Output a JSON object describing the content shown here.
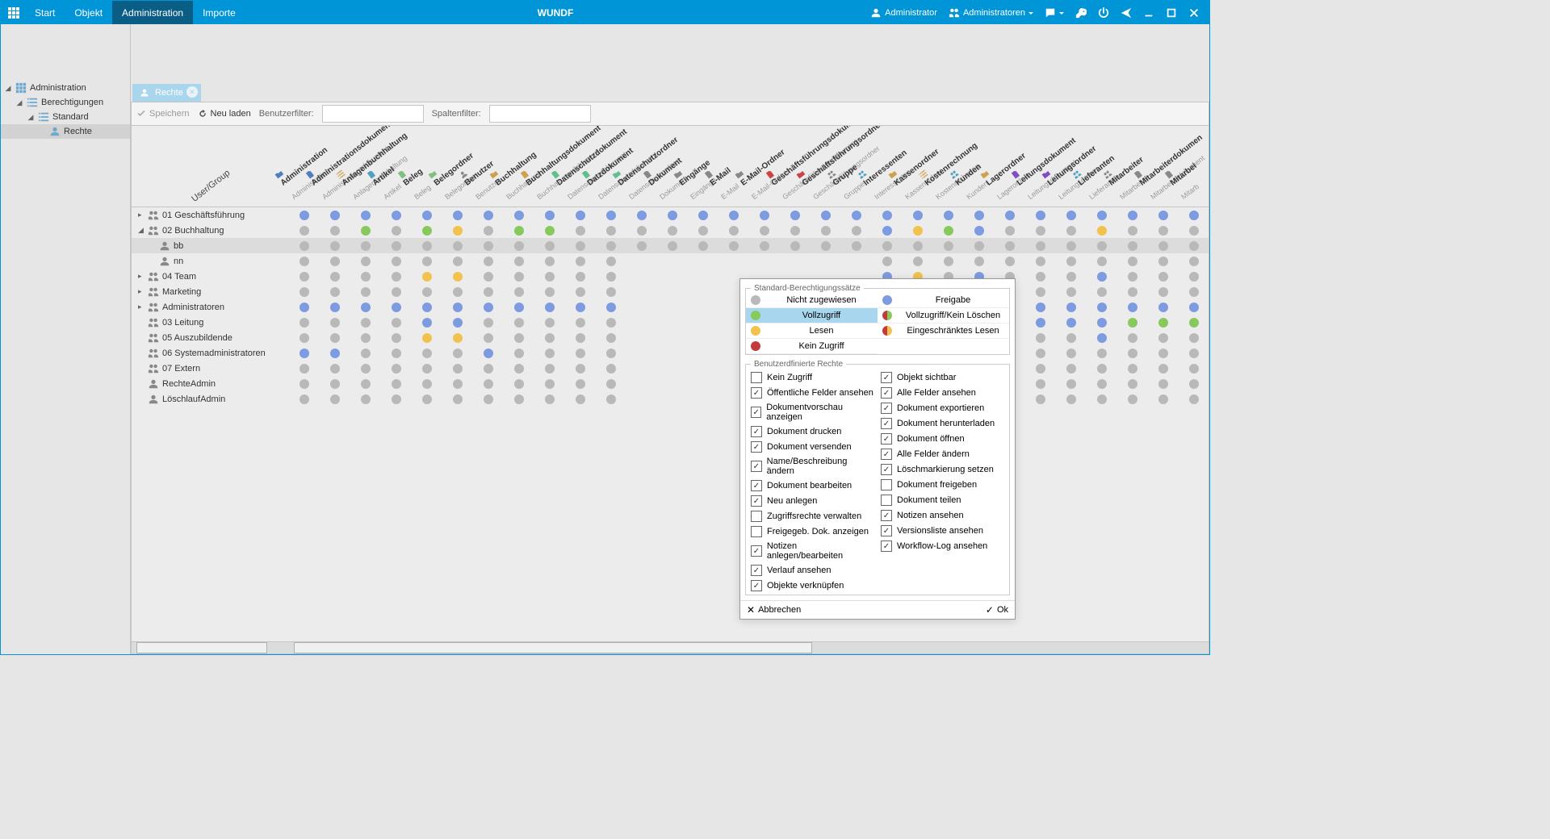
{
  "app_title": "WUNDF",
  "menu": {
    "items": [
      "Start",
      "Objekt",
      "Administration",
      "Importe"
    ],
    "active_index": 2
  },
  "topright": {
    "user": "Administrator",
    "group": "Administratoren"
  },
  "tree": {
    "nodes": [
      {
        "label": "Administration",
        "icon": "grid",
        "indent": 0,
        "open": true
      },
      {
        "label": "Berechtigungen",
        "icon": "list",
        "indent": 1,
        "open": true
      },
      {
        "label": "Standard",
        "icon": "list",
        "indent": 2,
        "open": true
      },
      {
        "label": "Rechte",
        "icon": "person",
        "indent": 3,
        "selected": true
      }
    ]
  },
  "tab": {
    "label": "Rechte"
  },
  "toolbar": {
    "save": "Speichern",
    "reload": "Neu laden",
    "filter_user_label": "Benutzerfilter:",
    "filter_col_label": "Spaltenfilter:"
  },
  "grid": {
    "corner": "User/Group",
    "columns": [
      {
        "n": "Administration",
        "s": "Administration"
      },
      {
        "n": "Administrationsdokument",
        "s": "Administrationsdokument"
      },
      {
        "n": "Anlagenbuchhaltung",
        "s": "Anlagenbuchhaltung"
      },
      {
        "n": "Artikel",
        "s": "Artikel"
      },
      {
        "n": "Beleg",
        "s": "Beleg"
      },
      {
        "n": "Belegordner",
        "s": "Belegordner"
      },
      {
        "n": "Benutzer",
        "s": "Benutzer"
      },
      {
        "n": "Buchhaltung",
        "s": "Buchhaltung"
      },
      {
        "n": "Buchhaltungsdokument",
        "s": "Buchhaltungsdokument"
      },
      {
        "n": "Datenschutzdokument",
        "s": "Datenschutzdokument"
      },
      {
        "n": "Datzdokument",
        "s": "Datenschutzdokument"
      },
      {
        "n": "Datenschutzordner",
        "s": "Datenschutzordner"
      },
      {
        "n": "Dokument",
        "s": "Dokument"
      },
      {
        "n": "Eingänge",
        "s": "Eingänge"
      },
      {
        "n": "E-Mail",
        "s": "E-Mail"
      },
      {
        "n": "E-Mail-Ordner",
        "s": "E-Mail-Ordner"
      },
      {
        "n": "Geschäftsführungsdokume.",
        "s": "Geschäftsführungsdokument"
      },
      {
        "n": "Geschäftsführungsordner",
        "s": "Geschäftsführungsordner"
      },
      {
        "n": "Gruppe",
        "s": "Gruppe"
      },
      {
        "n": "Interessenten",
        "s": "Interessenten"
      },
      {
        "n": "Kassenordner",
        "s": "Kassenordner"
      },
      {
        "n": "Kostenrechnung",
        "s": "Kostenrechnung"
      },
      {
        "n": "Kunden",
        "s": "Kunden"
      },
      {
        "n": "Lagerordner",
        "s": "Lagerordner"
      },
      {
        "n": "Leitungsdokument",
        "s": "Leitungsdokument"
      },
      {
        "n": "Leitungsordner",
        "s": "Leitungsordner"
      },
      {
        "n": "Lieferanten",
        "s": "Lieferanten"
      },
      {
        "n": "Mitarbeiter",
        "s": "Mitarbeiter"
      },
      {
        "n": "Mitarbeiterdokumen",
        "s": "Mitarbeiterdokument"
      },
      {
        "n": "Mitarbei",
        "s": "Mitarb"
      }
    ],
    "rows": [
      {
        "label": "01 Geschäftsführung",
        "type": "group",
        "indent": 0,
        "arrow": "right",
        "cells": [
          "b",
          "b",
          "b",
          "b",
          "b",
          "b",
          "b",
          "b",
          "b",
          "b",
          "b",
          "b",
          "b",
          "b",
          "b",
          "b",
          "b",
          "b",
          "b",
          "b",
          "b",
          "b",
          "b",
          "b",
          "b",
          "b",
          "b",
          "b",
          "b",
          "b"
        ]
      },
      {
        "label": "02 Buchhaltung",
        "type": "group",
        "indent": 0,
        "arrow": "down",
        "cells": [
          "g",
          "g",
          "gr",
          "g",
          "gr",
          "y",
          "g",
          "gr",
          "gr",
          "g",
          "g",
          "g",
          "g",
          "g",
          "g",
          "g",
          "g",
          "g",
          "g",
          "b",
          "y",
          "gr",
          "b",
          "g",
          "g",
          "g",
          "y",
          "g",
          "g",
          "g"
        ]
      },
      {
        "label": "bb",
        "type": "user",
        "indent": 1,
        "arrow": "",
        "cells": [
          "g",
          "g",
          "g",
          "g",
          "g",
          "g",
          "g",
          "g",
          "g",
          "g",
          "g",
          "g",
          "g",
          "g",
          "g",
          "g",
          "g",
          "g",
          "g",
          "g",
          "g",
          "g",
          "g",
          "g",
          "g",
          "g",
          "g",
          "g",
          "g",
          "g"
        ],
        "selected": true
      },
      {
        "label": "nn",
        "type": "user",
        "indent": 1,
        "arrow": "",
        "cells": [
          "g",
          "g",
          "g",
          "g",
          "g",
          "g",
          "g",
          "g",
          "g",
          "g",
          "g",
          "",
          "",
          "",
          "",
          "",
          "",
          "",
          "",
          "g",
          "g",
          "g",
          "g",
          "g",
          "g",
          "g",
          "g",
          "g",
          "g",
          "g"
        ]
      },
      {
        "label": "04 Team",
        "type": "group",
        "indent": 0,
        "arrow": "right",
        "cells": [
          "g",
          "g",
          "g",
          "g",
          "y",
          "y",
          "g",
          "g",
          "g",
          "g",
          "g",
          "",
          "",
          "",
          "",
          "",
          "",
          "",
          "",
          "b",
          "y",
          "g",
          "b",
          "g",
          "g",
          "g",
          "b",
          "g",
          "g",
          "g"
        ]
      },
      {
        "label": "Marketing",
        "type": "group",
        "indent": 0,
        "arrow": "right",
        "cells": [
          "g",
          "g",
          "g",
          "g",
          "g",
          "g",
          "g",
          "g",
          "g",
          "g",
          "g",
          "",
          "",
          "",
          "",
          "",
          "",
          "",
          "",
          "g",
          "g",
          "g",
          "g",
          "g",
          "g",
          "g",
          "g",
          "g",
          "g",
          "g"
        ]
      },
      {
        "label": "Administratoren",
        "type": "group",
        "indent": 0,
        "arrow": "right",
        "cells": [
          "b",
          "b",
          "b",
          "b",
          "b",
          "b",
          "b",
          "b",
          "b",
          "b",
          "b",
          "",
          "",
          "",
          "",
          "",
          "",
          "",
          "",
          "b",
          "b",
          "b",
          "b",
          "b",
          "b",
          "b",
          "b",
          "b",
          "b",
          "b"
        ]
      },
      {
        "label": "03 Leitung",
        "type": "group",
        "indent": 0,
        "arrow": "",
        "cells": [
          "g",
          "g",
          "g",
          "g",
          "b",
          "b",
          "g",
          "g",
          "g",
          "g",
          "g",
          "",
          "",
          "",
          "",
          "",
          "",
          "",
          "",
          "b",
          "b",
          "g",
          "b",
          "g",
          "b",
          "b",
          "b",
          "gr",
          "gr",
          "gr"
        ]
      },
      {
        "label": "05 Auszubildende",
        "type": "group",
        "indent": 0,
        "arrow": "",
        "cells": [
          "g",
          "g",
          "g",
          "g",
          "y",
          "y",
          "g",
          "g",
          "g",
          "g",
          "g",
          "",
          "",
          "",
          "",
          "",
          "",
          "",
          "",
          "b",
          "y",
          "g",
          "b",
          "g",
          "g",
          "g",
          "b",
          "g",
          "g",
          "g"
        ]
      },
      {
        "label": "06 Systemadministratoren",
        "type": "group",
        "indent": 0,
        "arrow": "",
        "cells": [
          "b",
          "b",
          "g",
          "g",
          "g",
          "g",
          "b",
          "g",
          "g",
          "g",
          "g",
          "",
          "",
          "",
          "",
          "",
          "",
          "",
          "",
          "g",
          "g",
          "g",
          "g",
          "g",
          "g",
          "g",
          "g",
          "g",
          "g",
          "g"
        ]
      },
      {
        "label": "07 Extern",
        "type": "group",
        "indent": 0,
        "arrow": "",
        "cells": [
          "g",
          "g",
          "g",
          "g",
          "g",
          "g",
          "g",
          "g",
          "g",
          "g",
          "g",
          "",
          "",
          "",
          "",
          "",
          "",
          "",
          "",
          "g",
          "g",
          "g",
          "g",
          "g",
          "g",
          "g",
          "g",
          "g",
          "g",
          "g"
        ]
      },
      {
        "label": "RechteAdmin",
        "type": "user",
        "indent": 0,
        "arrow": "",
        "cells": [
          "g",
          "g",
          "g",
          "g",
          "g",
          "g",
          "g",
          "g",
          "g",
          "g",
          "g",
          "",
          "",
          "",
          "",
          "",
          "",
          "",
          "",
          "g",
          "g",
          "g",
          "g",
          "g",
          "g",
          "g",
          "g",
          "g",
          "g",
          "g"
        ]
      },
      {
        "label": "LöschlaufAdmin",
        "type": "user",
        "indent": 0,
        "arrow": "",
        "cells": [
          "g",
          "g",
          "g",
          "g",
          "g",
          "g",
          "g",
          "g",
          "g",
          "g",
          "g",
          "",
          "",
          "",
          "",
          "",
          "",
          "",
          "",
          "g",
          "g",
          "g",
          "g",
          "g",
          "g",
          "g",
          "g",
          "g",
          "g",
          "g"
        ]
      }
    ]
  },
  "dialog": {
    "legend_title": "Standard-Berechtigungssätze",
    "legend": [
      {
        "color": "#b9b9b9",
        "label": "Nicht zugewiesen"
      },
      {
        "color": "#7d9be0",
        "label": "Freigabe"
      },
      {
        "color": "#88c95e",
        "label": "Vollzugriff",
        "selected": true
      },
      {
        "color": "half-red-green",
        "label": "Vollzugriff/Kein Löschen"
      },
      {
        "color": "#f2c24f",
        "label": "Lesen"
      },
      {
        "color": "half-red-yellow",
        "label": "Eingeschränktes Lesen"
      },
      {
        "color": "#c43a3a",
        "label": "Kein Zugriff"
      }
    ],
    "rights_title": "Benutzerdfinierte Rechte",
    "rights_left": [
      {
        "l": "Kein Zugriff",
        "c": false
      },
      {
        "l": "Öffentliche Felder ansehen",
        "c": true
      },
      {
        "l": "Dokumentvorschau anzeigen",
        "c": true
      },
      {
        "l": "Dokument drucken",
        "c": true
      },
      {
        "l": "Dokument versenden",
        "c": true
      },
      {
        "l": "Name/Beschreibung ändern",
        "c": true
      },
      {
        "l": "Dokument bearbeiten",
        "c": true
      },
      {
        "l": "Neu anlegen",
        "c": true
      },
      {
        "l": "Zugriffsrechte verwalten",
        "c": false
      },
      {
        "l": "Freigegeb. Dok. anzeigen",
        "c": false
      },
      {
        "l": "Notizen anlegen/bearbeiten",
        "c": true
      },
      {
        "l": "Verlauf ansehen",
        "c": true
      },
      {
        "l": "Objekte verknüpfen",
        "c": true
      }
    ],
    "rights_right": [
      {
        "l": "Objekt sichtbar",
        "c": true
      },
      {
        "l": "Alle Felder ansehen",
        "c": true
      },
      {
        "l": "Dokument exportieren",
        "c": true
      },
      {
        "l": "Dokument herunterladen",
        "c": true
      },
      {
        "l": "Dokument öffnen",
        "c": true
      },
      {
        "l": "Alle Felder ändern",
        "c": true
      },
      {
        "l": "Löschmarkierung setzen",
        "c": true
      },
      {
        "l": "Dokument freigeben",
        "c": false
      },
      {
        "l": "Dokument teilen",
        "c": false
      },
      {
        "l": "Notizen ansehen",
        "c": true
      },
      {
        "l": "Versionsliste ansehen",
        "c": true
      },
      {
        "l": "Workflow-Log ansehen",
        "c": true
      }
    ],
    "btn_cancel": "Abbrechen",
    "btn_ok": "Ok"
  },
  "colors": {
    "b": "#7d9be0",
    "g": "#b9b9b9",
    "gr": "#88c95e",
    "y": "#f2c24f",
    "r": "#c43a3a"
  }
}
